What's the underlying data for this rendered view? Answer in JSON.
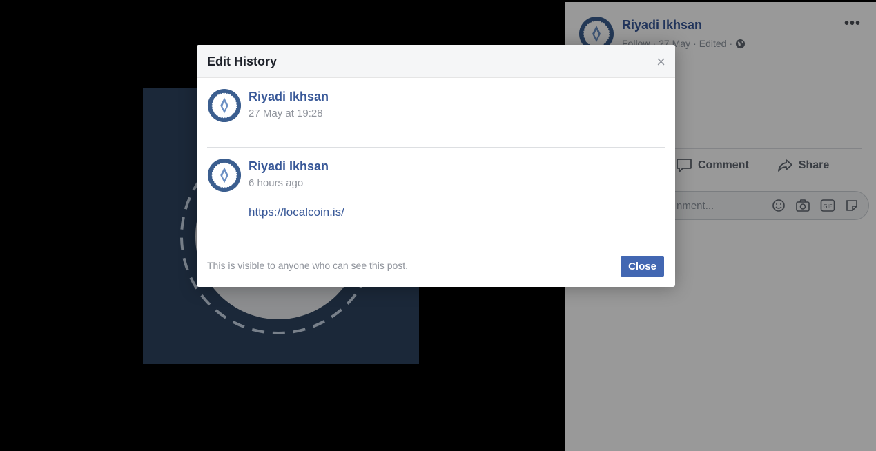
{
  "post": {
    "author": "Riyadi Ikhsan",
    "meta_follow": "Follow",
    "meta_date": "27 May",
    "meta_edited": "Edited",
    "text_fragment": "/",
    "comment_label": "Comment",
    "share_label": "Share",
    "comment_placeholder": "nment..."
  },
  "dialog": {
    "title": "Edit History",
    "close_x": "×",
    "entries": [
      {
        "author": "Riyadi Ikhsan",
        "time": "27 May at 19:28",
        "link": ""
      },
      {
        "author": "Riyadi Ikhsan",
        "time": "6 hours ago",
        "link": "https://localcoin.is/"
      }
    ],
    "footer_text": "This is visible to anyone who can see this post.",
    "close_button": "Close"
  },
  "colors": {
    "brand_blue": "#4267b2",
    "link_blue": "#385898",
    "photo_bg": "#2e4460"
  }
}
